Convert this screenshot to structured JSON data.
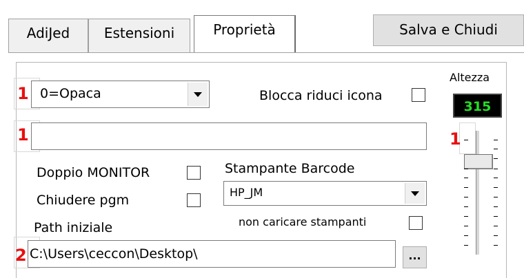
{
  "tabs": [
    {
      "label": "AdiJed"
    },
    {
      "label": "Estensioni"
    },
    {
      "label": "Proprietà",
      "active": true
    }
  ],
  "save_button": {
    "label": "Salva e Chiudi"
  },
  "altezza": {
    "label": "Altezza",
    "value": "315"
  },
  "markers": [
    "1",
    "1",
    "1",
    "2"
  ],
  "opacity_combo": {
    "value": "0=Opaca"
  },
  "blocca_riduci_icona": {
    "label": "Blocca riduci icona",
    "checked": false
  },
  "text_field": {
    "value": ""
  },
  "doppio_monitor": {
    "label": "Doppio MONITOR",
    "checked": false
  },
  "chiudere_pgm": {
    "label": "Chiudere pgm",
    "checked": false
  },
  "stampante_barcode": {
    "label": "Stampante Barcode",
    "value": "HP_JM"
  },
  "non_caricare_stampanti": {
    "label": "non caricare stampanti",
    "checked": false
  },
  "path_iniziale": {
    "label": "Path iniziale",
    "value": "C:\\Users\\ceccon\\Desktop\\",
    "browse_label": "..."
  },
  "colors": {
    "accent_red": "#e81010",
    "lcd_green": "#22e022",
    "lcd_bg": "#000000"
  }
}
